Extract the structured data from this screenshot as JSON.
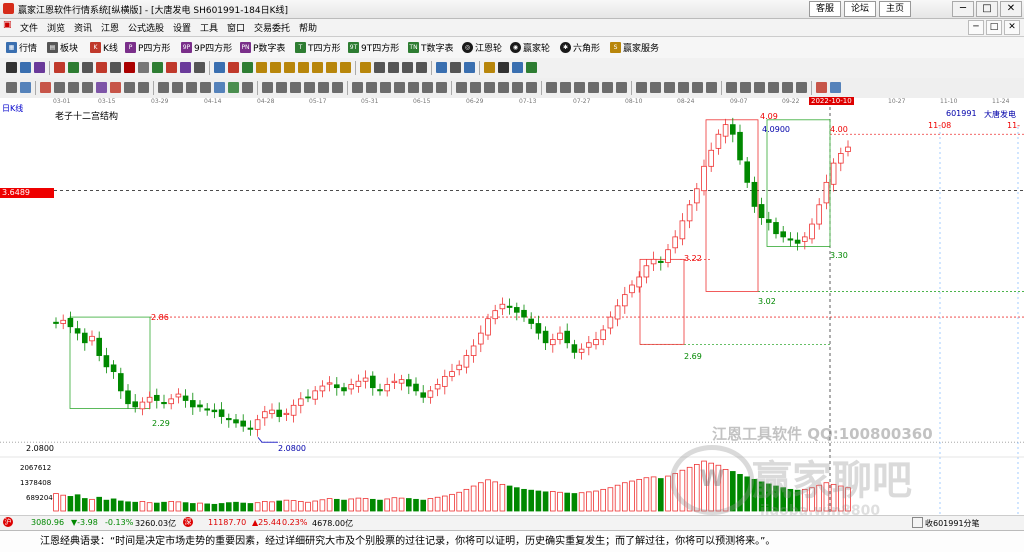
{
  "window": {
    "title": "赢家江恩软件行情系统[纵横版] - [大唐发电  SH601991-184日K线]",
    "links": [
      "客服",
      "论坛",
      "主页"
    ],
    "controls": [
      "─",
      "□",
      "✕"
    ]
  },
  "menu": {
    "items": [
      "文件",
      "浏览",
      "资讯",
      "江恩",
      "公式选股",
      "设置",
      "工具",
      "窗口",
      "交易委托",
      "帮助"
    ],
    "doc_controls": [
      "─",
      "□",
      "✕"
    ]
  },
  "toolbar1": {
    "items": [
      {
        "label": "行情",
        "icon": "quotes-icon",
        "color": "#3a6fb0"
      },
      {
        "label": "板块",
        "icon": "sector-icon",
        "color": "#555555"
      },
      {
        "label": "K线",
        "icon": "candlestick-icon",
        "color": "#c0392b"
      },
      {
        "label": "P四方形",
        "icon": "square-p-icon",
        "color": "#7a2f8a"
      },
      {
        "label": "9P四方形",
        "icon": "square-9p-icon",
        "color": "#7a2f8a"
      },
      {
        "label": "P数字表",
        "icon": "number-table-p-icon",
        "color": "#7a2f8a"
      },
      {
        "label": "T四方形",
        "icon": "square-t-icon",
        "color": "#2e7d32"
      },
      {
        "label": "9T四方形",
        "icon": "square-9t-icon",
        "color": "#2e7d32"
      },
      {
        "label": "T数字表",
        "icon": "number-table-t-icon",
        "color": "#2e7d32"
      },
      {
        "label": "江恩轮",
        "icon": "gann-wheel-icon",
        "color": "#1a1a1a"
      },
      {
        "label": "赢家轮",
        "icon": "winner-wheel-icon",
        "color": "#1a1a1a"
      },
      {
        "label": "六角形",
        "icon": "hexagon-icon",
        "color": "#1a1a1a"
      },
      {
        "label": "赢家服务",
        "icon": "service-icon",
        "color": "#b8860b"
      }
    ]
  },
  "dates": [
    "03-01",
    "03-15",
    "03-29",
    "04-14",
    "04-28",
    "05-17",
    "05-31",
    "06-15",
    "06-29",
    "07-13",
    "07-27",
    "08-10",
    "08-24",
    "09-07",
    "09-22",
    "2022-10-10",
    "10-27",
    "11-10",
    "11-24"
  ],
  "chart": {
    "period_label": "日K线",
    "indicator_name": "老子十二宫结构",
    "stock_code": "601991",
    "stock_name": "大唐发电",
    "current_price_tag": "3.6489",
    "price_low_axis": "2.0800",
    "level_labels": {
      "p409": "4.09",
      "p4090": "4.0900",
      "p400": "4.00",
      "p286": "2.86",
      "p229": "2.29",
      "p2080": "2.0800",
      "p322": "3.22",
      "p302": "3.02",
      "p269": "2.69",
      "p330": "3.30"
    },
    "date_marks": [
      "11-08",
      "11-"
    ],
    "volume_axis": [
      "2067612",
      "1378408",
      "689204"
    ],
    "watermark_line1": "江恩工具软件  QQ:100800360",
    "watermark_line2": "赢家聊吧",
    "watermark_line3": "jiaoba.win8800"
  },
  "chart_data": {
    "type": "candlestick",
    "symbol": "SH601991",
    "period": "日K线",
    "marked_levels": [
      2.08,
      2.29,
      2.69,
      2.86,
      3.02,
      3.22,
      3.3,
      4.0,
      4.09
    ],
    "current_price": 3.6489,
    "close_approx": [
      2.82,
      2.84,
      2.8,
      2.76,
      2.7,
      2.74,
      2.62,
      2.55,
      2.52,
      2.4,
      2.32,
      2.3,
      2.33,
      2.36,
      2.34,
      2.32,
      2.35,
      2.38,
      2.34,
      2.3,
      2.3,
      2.28,
      2.27,
      2.24,
      2.22,
      2.2,
      2.18,
      2.16,
      2.22,
      2.27,
      2.28,
      2.24,
      2.26,
      2.31,
      2.35,
      2.36,
      2.4,
      2.43,
      2.45,
      2.42,
      2.4,
      2.44,
      2.46,
      2.48,
      2.42,
      2.4,
      2.44,
      2.46,
      2.47,
      2.43,
      2.4,
      2.36,
      2.4,
      2.44,
      2.49,
      2.52,
      2.56,
      2.62,
      2.68,
      2.76,
      2.85,
      2.9,
      2.94,
      2.92,
      2.89,
      2.86,
      2.82,
      2.76,
      2.7,
      2.72,
      2.76,
      2.7,
      2.64,
      2.66,
      2.7,
      2.72,
      2.78,
      2.86,
      2.93,
      3.0,
      3.06,
      3.11,
      3.18,
      3.22,
      3.2,
      3.28,
      3.36,
      3.46,
      3.56,
      3.66,
      3.8,
      3.9,
      4.0,
      4.06,
      4.0,
      3.84,
      3.7,
      3.55,
      3.48,
      3.45,
      3.38,
      3.36,
      3.34,
      3.32,
      3.36,
      3.44,
      3.56,
      3.7,
      3.82,
      3.88,
      3.92
    ],
    "volume_approx": [
      420,
      380,
      350,
      390,
      300,
      280,
      330,
      260,
      290,
      240,
      220,
      210,
      230,
      200,
      190,
      210,
      230,
      220,
      200,
      180,
      190,
      170,
      160,
      180,
      200,
      210,
      190,
      180,
      200,
      230,
      220,
      240,
      260,
      250,
      230,
      210,
      240,
      270,
      300,
      280,
      260,
      290,
      310,
      300,
      280,
      260,
      290,
      320,
      310,
      300,
      280,
      260,
      300,
      330,
      360,
      400,
      450,
      520,
      600,
      680,
      750,
      700,
      640,
      600,
      560,
      520,
      500,
      480,
      460,
      470,
      450,
      430,
      420,
      440,
      460,
      480,
      520,
      560,
      620,
      680,
      720,
      760,
      800,
      820,
      780,
      840,
      900,
      980,
      1050,
      1120,
      1200,
      1150,
      1100,
      1000,
      950,
      880,
      820,
      760,
      700,
      650,
      600,
      560,
      520,
      500,
      520,
      560,
      620,
      680,
      640,
      600,
      560
    ]
  },
  "status": {
    "index1": "3080.96",
    "index1_change": "▼-3.98",
    "index1_pct": "-0.13%",
    "index1_amount": "3260.03亿",
    "index2": "11187.70",
    "index2_change": "▲25.44",
    "index2_pct": "0.23%",
    "index2_amount": "4678.00亿",
    "right_text": "收601991分笔"
  },
  "quote_text": "江恩经典语录：“时间是决定市场走势的重要因素，经过详细研究大市及个别股票的过往记录，你将可以证明，历史确实重复发生；而了解过往，你将可以预测将来。”。"
}
